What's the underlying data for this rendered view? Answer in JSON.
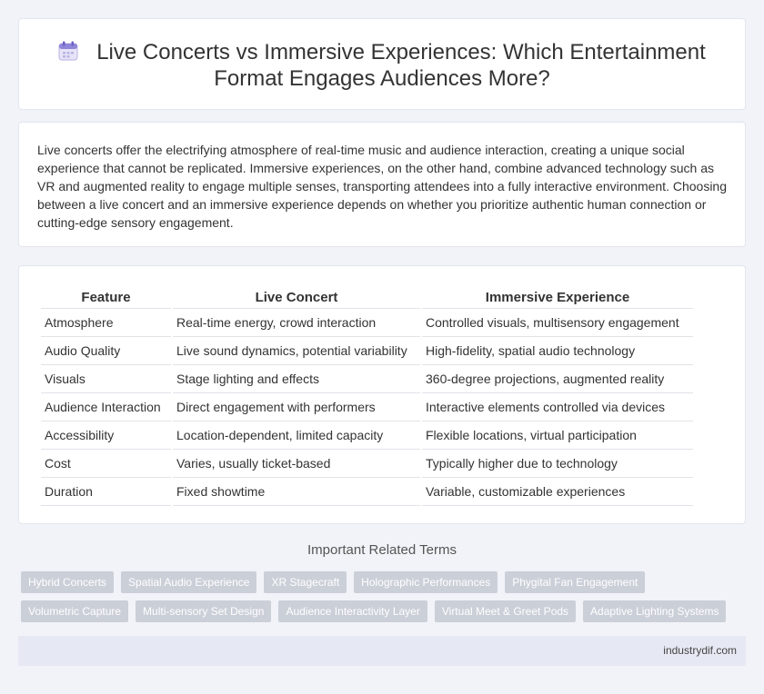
{
  "header": {
    "title_line1": "Live Concerts vs Immersive Experiences: Which Entertainment",
    "title_line2": "Format Engages Audiences More?",
    "icon": "calendar-icon"
  },
  "intro": {
    "text": "Live concerts offer the electrifying atmosphere of real-time music and audience interaction, creating a unique social experience that cannot be replicated. Immersive experiences, on the other hand, combine advanced technology such as VR and augmented reality to engage multiple senses, transporting attendees into a fully interactive environment. Choosing between a live concert and an immersive experience depends on whether you prioritize authentic human connection or cutting-edge sensory engagement."
  },
  "table": {
    "headers": [
      "Feature",
      "Live Concert",
      "Immersive Experience"
    ],
    "rows": [
      [
        "Atmosphere",
        "Real-time energy, crowd interaction",
        "Controlled visuals, multisensory engagement"
      ],
      [
        "Audio Quality",
        "Live sound dynamics, potential variability",
        "High-fidelity, spatial audio technology"
      ],
      [
        "Visuals",
        "Stage lighting and effects",
        "360-degree projections, augmented reality"
      ],
      [
        "Audience Interaction",
        "Direct engagement with performers",
        "Interactive elements controlled via devices"
      ],
      [
        "Accessibility",
        "Location-dependent, limited capacity",
        "Flexible locations, virtual participation"
      ],
      [
        "Cost",
        "Varies, usually ticket-based",
        "Typically higher due to technology"
      ],
      [
        "Duration",
        "Fixed showtime",
        "Variable, customizable experiences"
      ]
    ]
  },
  "related": {
    "title": "Important Related Terms",
    "tags": [
      "Hybrid Concerts",
      "Spatial Audio Experience",
      "XR Stagecraft",
      "Holographic Performances",
      "Phygital Fan Engagement",
      "Volumetric Capture",
      "Multi-sensory Set Design",
      "Audience Interactivity Layer",
      "Virtual Meet & Greet Pods",
      "Adaptive Lighting Systems"
    ]
  },
  "footer": {
    "site": "industrydif.com"
  }
}
